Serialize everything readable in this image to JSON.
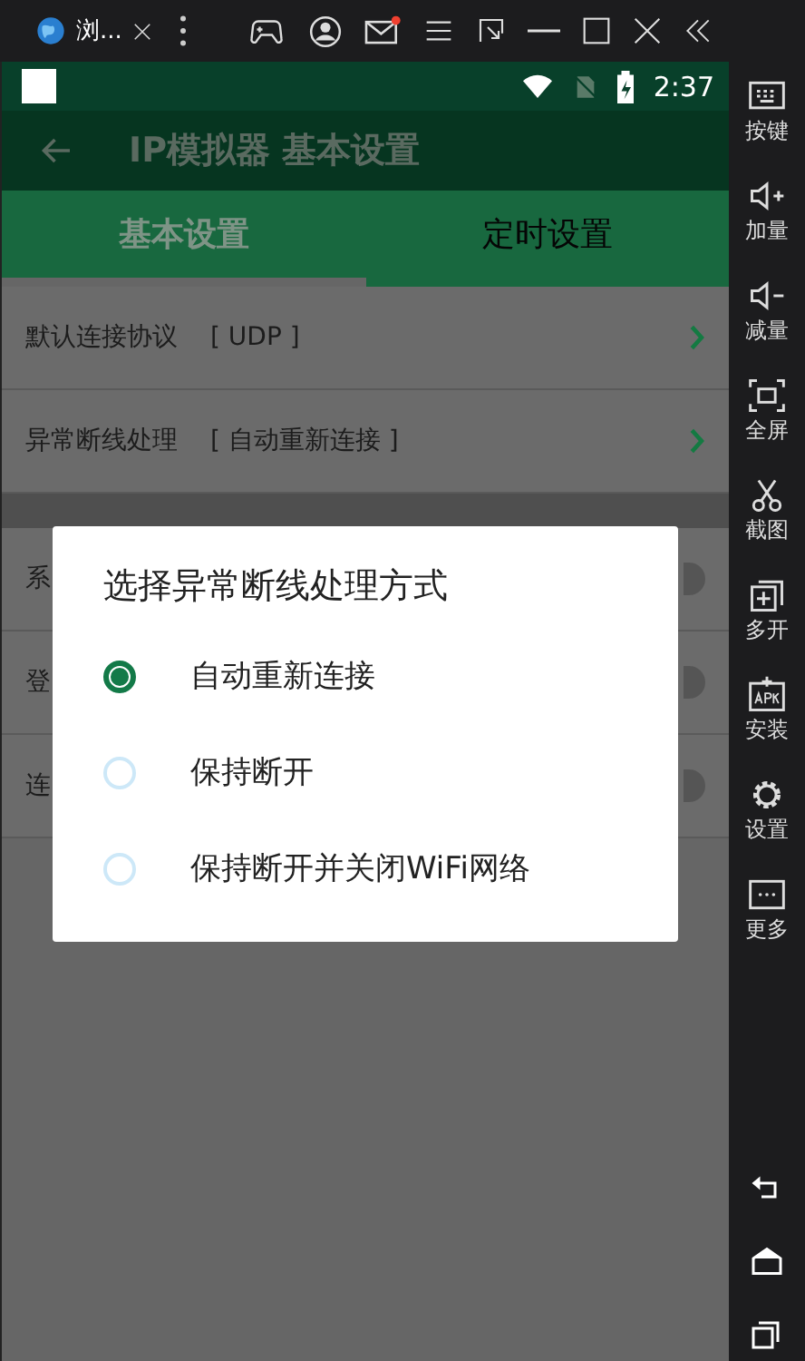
{
  "window": {
    "tab_title": "浏..."
  },
  "status_bar": {
    "time": "2:37"
  },
  "app_bar": {
    "title": "IP模拟器 基本设置"
  },
  "tabs": [
    {
      "label": "基本设置",
      "selected": true
    },
    {
      "label": "定时设置",
      "selected": false
    }
  ],
  "settings": [
    {
      "kind": "link",
      "label": "默认连接协议",
      "value": "[ UDP ]"
    },
    {
      "kind": "link",
      "label": "异常断线处理",
      "value": "[ 自动重新连接 ]"
    },
    {
      "kind": "gap"
    },
    {
      "kind": "switch",
      "label": "系",
      "on": false
    },
    {
      "kind": "switch",
      "label": "登",
      "on": false
    },
    {
      "kind": "switch",
      "label": "连",
      "on": false
    }
  ],
  "dialog": {
    "title": "选择异常断线处理方式",
    "options": [
      {
        "label": "自动重新连接",
        "selected": true
      },
      {
        "label": "保持断开",
        "selected": false
      },
      {
        "label": "保持断开并关闭WiFi网络",
        "selected": false
      }
    ]
  },
  "sidebar": {
    "items": [
      {
        "kind": "keyboard",
        "label": "按键"
      },
      {
        "kind": "volup",
        "label": "加量"
      },
      {
        "kind": "voldown",
        "label": "减量"
      },
      {
        "kind": "fullscreen",
        "label": "全屏"
      },
      {
        "kind": "scissors",
        "label": "截图"
      },
      {
        "kind": "multi",
        "label": "多开"
      },
      {
        "kind": "apk",
        "label": "安装"
      },
      {
        "kind": "gear",
        "label": "设置"
      },
      {
        "kind": "more",
        "label": "更多"
      }
    ]
  }
}
